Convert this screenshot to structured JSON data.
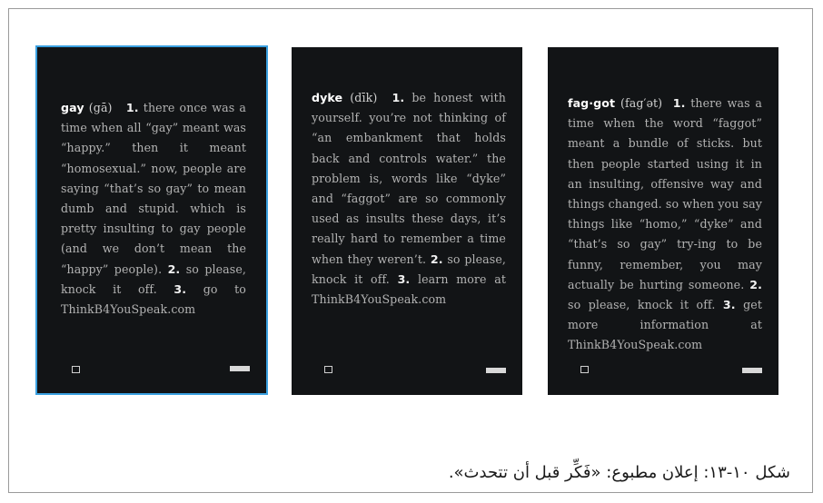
{
  "posters": [
    {
      "word": "gay",
      "pron": "(gā)",
      "n1": "1.",
      "text1": "there once was a time when all “gay” meant was “happy.” then it meant “homosexual.” now, people are saying “that’s so gay” to mean dumb and stupid. which is pretty insulting to gay people (and we don’t mean the “happy” people).",
      "n2": "2.",
      "text2": "so please, knock it off.",
      "n3": "3.",
      "text3": "go to ThinkB4YouSpeak.com"
    },
    {
      "word": "dyke",
      "pron": "(dīk)",
      "n1": "1.",
      "text1": "be honest with yourself. you’re not thinking of “an embankment that holds back and controls water.” the problem is, words like “dyke” and “faggot” are so commonly used as insults these days, it’s really hard to remember a time when they weren’t.",
      "n2": "2.",
      "text2": "so please, knock it off.",
      "n3": "3.",
      "text3": "learn more at ThinkB4YouSpeak.com"
    },
    {
      "word": "fag·got",
      "pron": "(fag′ət)",
      "n1": "1.",
      "text1": "there was a time when the word “faggot” meant a bundle of sticks. but then people started using it in an insulting, offensive way and things changed. so when you say things like “homo,” “dyke” and “that’s so gay” try-ing to be funny, remember, you may actually be hurting someone.",
      "n2": "2.",
      "text2": "so please, knock it off.",
      "n3": "3.",
      "text3": "get more information at ThinkB4YouSpeak.com"
    }
  ],
  "caption": "شكل ١٠-١٣: إعلان مطبوع: «فَكِّر قبل أن تتحدث»."
}
